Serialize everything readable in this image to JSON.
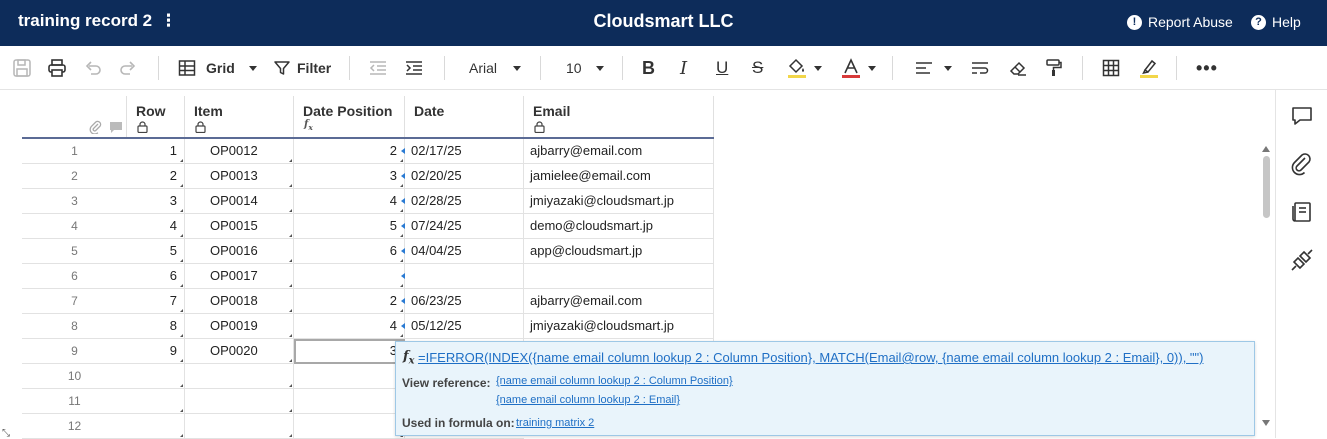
{
  "header": {
    "sheet_title": "training record 2",
    "menu_glyph": "⋮",
    "org_name": "Cloudsmart LLC",
    "report_abuse": "Report Abuse",
    "help": "Help"
  },
  "toolbar": {
    "view_label": "Grid",
    "filter_label": "Filter",
    "font_family": "Arial",
    "font_size": "10"
  },
  "columns": [
    {
      "label": "Row",
      "locked": true
    },
    {
      "label": "Item",
      "locked": true
    },
    {
      "label": "Date Position",
      "sub": "fx"
    },
    {
      "label": "Date"
    },
    {
      "label": "Email",
      "locked": true
    }
  ],
  "rows": [
    {
      "num": "1",
      "row": "1",
      "item": "OP0012",
      "pos": "2",
      "date": "02/17/25",
      "email": "ajbarry@email.com"
    },
    {
      "num": "2",
      "row": "2",
      "item": "OP0013",
      "pos": "3",
      "date": "02/20/25",
      "email": "jamielee@email.com"
    },
    {
      "num": "3",
      "row": "3",
      "item": "OP0014",
      "pos": "4",
      "date": "02/28/25",
      "email": "jmiyazaki@cloudsmart.jp"
    },
    {
      "num": "4",
      "row": "4",
      "item": "OP0015",
      "pos": "5",
      "date": "07/24/25",
      "email": "demo@cloudsmart.jp"
    },
    {
      "num": "5",
      "row": "5",
      "item": "OP0016",
      "pos": "6",
      "date": "04/04/25",
      "email": "app@cloudsmart.jp"
    },
    {
      "num": "6",
      "row": "6",
      "item": "OP0017",
      "pos": "",
      "date": "",
      "email": ""
    },
    {
      "num": "7",
      "row": "7",
      "item": "OP0018",
      "pos": "2",
      "date": "06/23/25",
      "email": "ajbarry@email.com"
    },
    {
      "num": "8",
      "row": "8",
      "item": "OP0019",
      "pos": "4",
      "date": "05/12/25",
      "email": "jmiyazaki@cloudsmart.jp"
    },
    {
      "num": "9",
      "row": "9",
      "item": "OP0020",
      "pos": "3",
      "date": "",
      "email": ""
    },
    {
      "num": "10",
      "row": "",
      "item": "",
      "pos": "",
      "date": "",
      "email": ""
    },
    {
      "num": "11",
      "row": "",
      "item": "",
      "pos": "",
      "date": "",
      "email": ""
    },
    {
      "num": "12",
      "row": "",
      "item": "",
      "pos": "",
      "date": "",
      "email": ""
    }
  ],
  "formula_popup": {
    "fx": "fx",
    "formula": "=IFERROR(INDEX({name email column lookup 2 : Column Position}, MATCH(Email@row, {name email column lookup 2 : Email}, 0)), \"\")",
    "view_reference_label": "View reference:",
    "references": [
      "{name email column lookup 2 : Column Position}",
      "{name email column lookup 2 : Email}"
    ],
    "used_in_label": "Used in formula on:",
    "used_in_link": "training matrix 2"
  },
  "colors": {
    "header_bg": "#0d2c5a",
    "link": "#1f6fc5",
    "popup_bg": "#e9f4fb"
  }
}
